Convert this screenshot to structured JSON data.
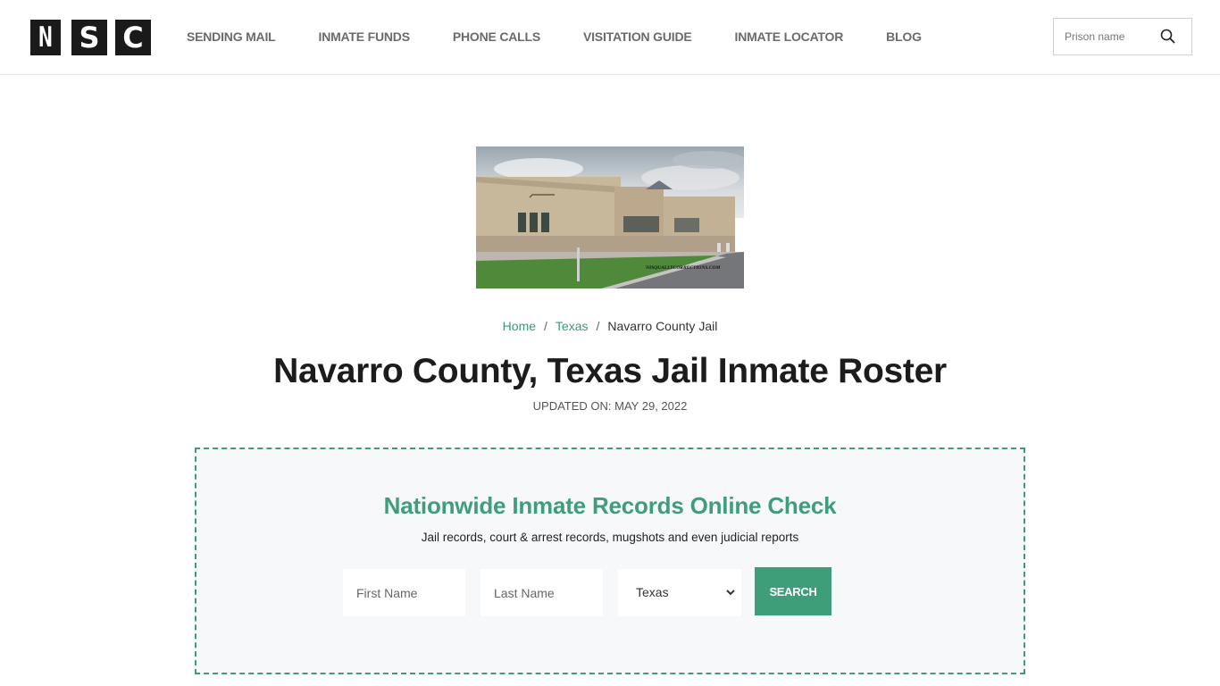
{
  "header": {
    "logo_letters": [
      "N",
      "S",
      "C"
    ],
    "nav": [
      {
        "label": "SENDING MAIL"
      },
      {
        "label": "INMATE FUNDS"
      },
      {
        "label": "PHONE CALLS"
      },
      {
        "label": "VISITATION GUIDE"
      },
      {
        "label": "INMATE LOCATOR"
      },
      {
        "label": "BLOG"
      }
    ],
    "search": {
      "placeholder": "Prison name",
      "icon": "search-icon"
    }
  },
  "photo": {
    "alt": "Navarro County Jail building",
    "watermark": "NISQUALLYCORRECTIONS.COM"
  },
  "breadcrumb": {
    "items": [
      {
        "label": "Home"
      },
      {
        "label": "Texas"
      },
      {
        "label": "Navarro County Jail"
      }
    ],
    "separator": "/"
  },
  "page": {
    "title": "Navarro County, Texas Jail Inmate Roster",
    "updated": "UPDATED ON: MAY 29, 2022"
  },
  "search_panel": {
    "title": "Nationwide Inmate Records Online Check",
    "subtitle": "Jail records, court & arrest records, mugshots and even judicial reports",
    "first_name_placeholder": "First Name",
    "last_name_placeholder": "Last Name",
    "state_selected": "Texas",
    "button_label": "SEARCH"
  },
  "colors": {
    "accent": "#3e9e7a",
    "logo_bg": "#1a1a1a",
    "panel_bg": "#f7f8fa"
  }
}
